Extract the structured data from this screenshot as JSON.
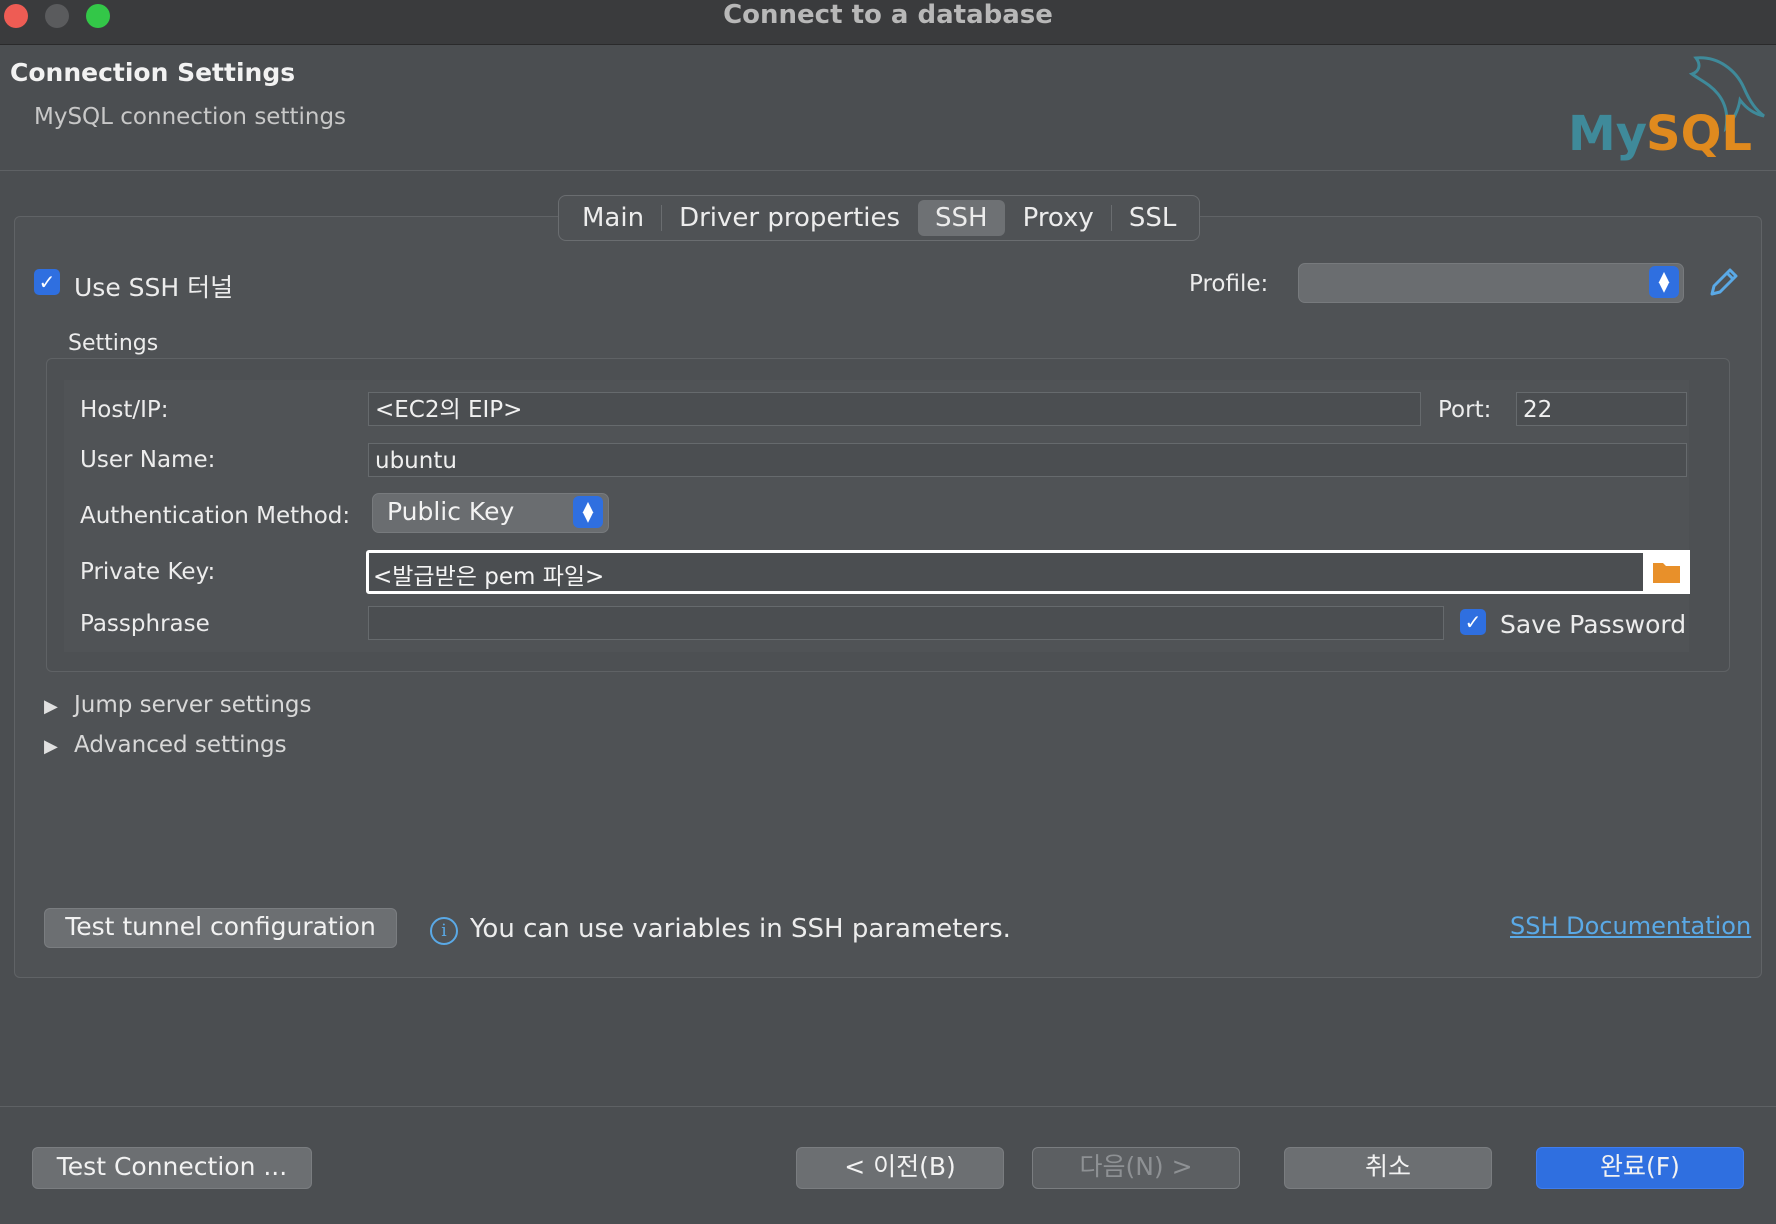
{
  "window": {
    "title": "Connect to a database"
  },
  "header": {
    "title": "Connection Settings",
    "subtitle": "MySQL connection settings",
    "logo_text": "MySQL"
  },
  "tabs": [
    {
      "label": "Main",
      "active": false
    },
    {
      "label": "Driver properties",
      "active": false
    },
    {
      "label": "SSH",
      "active": true
    },
    {
      "label": "Proxy",
      "active": false
    },
    {
      "label": "SSL",
      "active": false
    }
  ],
  "ssh": {
    "use_tunnel_label": "Use SSH 터널",
    "use_tunnel_checked": true,
    "profile_label": "Profile:",
    "profile_value": "",
    "settings_label": "Settings",
    "host_label": "Host/IP:",
    "host_value": "<EC2의 EIP>",
    "port_label": "Port:",
    "port_value": "22",
    "username_label": "User Name:",
    "username_value": "ubuntu",
    "auth_label": "Authentication Method:",
    "auth_value": "Public Key",
    "private_key_label": "Private Key:",
    "private_key_value": "<발급받은 pem 파일>",
    "passphrase_label": "Passphrase",
    "passphrase_value": "",
    "save_password_label": "Save Password",
    "save_password_checked": true,
    "jump_server_label": "Jump server settings",
    "advanced_label": "Advanced settings",
    "test_tunnel_label": "Test tunnel configuration",
    "info_text": "You can use variables in SSH parameters.",
    "doc_link": "SSH Documentation"
  },
  "footer": {
    "test_connection": "Test Connection ...",
    "back": "< 이전(B)",
    "next": "다음(N) >",
    "cancel": "취소",
    "finish": "완료(F)"
  },
  "colors": {
    "accent": "#2f6fe0",
    "link": "#5aa9e6",
    "folder": "#e8902a",
    "mysql_teal": "#3f8a9a",
    "mysql_orange": "#e08a1e"
  }
}
